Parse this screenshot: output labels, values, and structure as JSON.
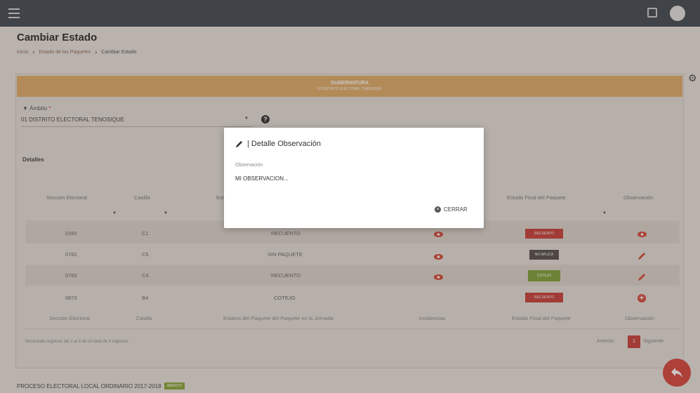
{
  "app": {
    "page_title": "Cambiar Estado",
    "breadcrumb": [
      "Inicio",
      "Estado de los Paquetes",
      "Cambiar Estado"
    ]
  },
  "banner": {
    "title": "GUBERNATURA",
    "subtitle": "01 DISTRITO ELECTORAL TENOSIQUE"
  },
  "ambito": {
    "label": "Ámbito",
    "required_mark": "*",
    "value": "01 DISTRITO ELECTORAL TENOSIQUE"
  },
  "detalles": {
    "title": "Detalles",
    "headers": {
      "seccion": "Sección Electoral",
      "casilla": "Casilla",
      "estatus": "Estatus del Paquete del Paquete en la Jornada",
      "incidencias": "Incidencias",
      "estado_final": "Estado Final del Paquete",
      "observacion": "Observación"
    },
    "rows": [
      {
        "seccion": "0350",
        "casilla": "C1",
        "estatus": "RECUENTO",
        "estado_final": "RECUENTO",
        "estado_color": "#c9403a",
        "icon": "eye-icon"
      },
      {
        "seccion": "0782",
        "casilla": "C5",
        "estatus": "SIN PAQUETE",
        "estado_final": "NO APLICA",
        "estado_color": "#55504c",
        "icon": "pencil-icon"
      },
      {
        "seccion": "0783",
        "casilla": "C4",
        "estatus": "RECUENTO",
        "estado_final": "COTEJO",
        "estado_color": "#7ea33a",
        "icon": "pencil-icon"
      },
      {
        "seccion": "0873",
        "casilla": "B4",
        "estatus": "COTEJO",
        "estado_final": "RECUENTO",
        "estado_color": "#c9403a",
        "icon": "plus-circle-icon"
      }
    ],
    "showing_text": "Mostrando registros del 1 al 4 de un total de 4 registros",
    "pagination": {
      "prev": "Anterior",
      "page": "1",
      "next": "Siguiente"
    }
  },
  "footer": {
    "proceso": "PROCESO ELECTORAL LOCAL ORDINARIO 2017-2018",
    "tag": "ABIERTO"
  },
  "modal": {
    "title": "| Detalle Observación",
    "field_label": "Observación",
    "field_value": "MI OBSERVACION...",
    "close_label": "CERRAR"
  },
  "colors": {
    "topbar": "#424a52",
    "banner": "#e0ae6a",
    "accent_red": "#c9403a",
    "accent_green": "#7ea33a"
  }
}
